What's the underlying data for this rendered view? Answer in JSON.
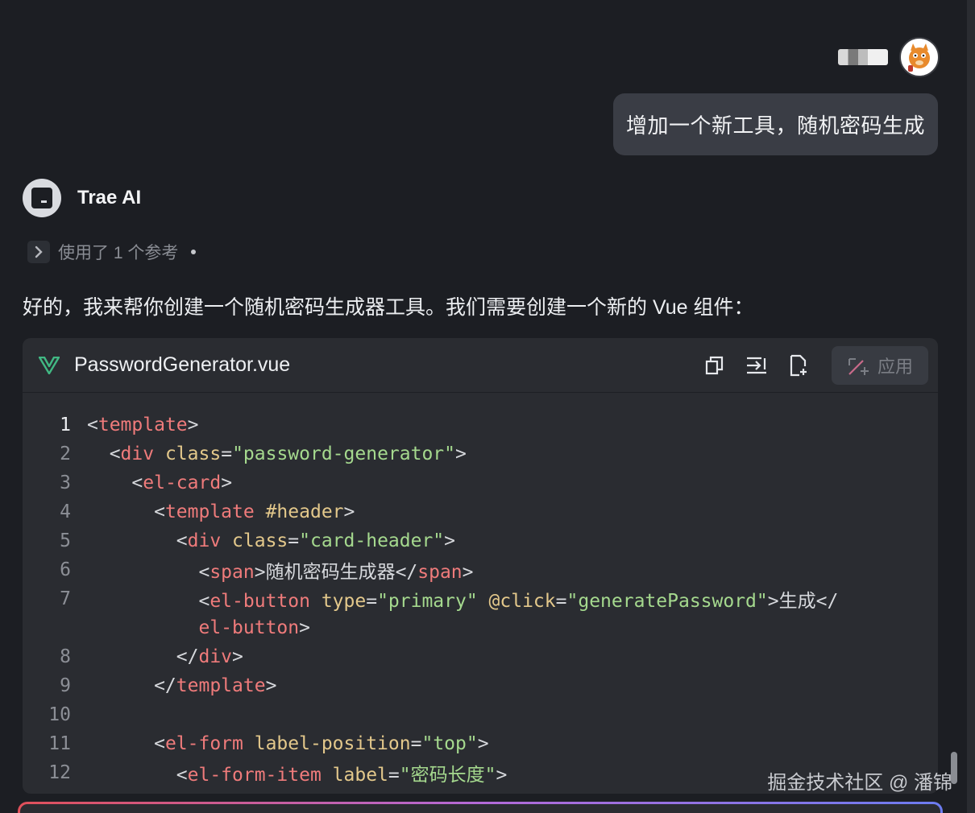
{
  "user": {
    "message": "增加一个新工具，随机密码生成"
  },
  "assistant": {
    "name": "Trae AI",
    "references_label": "使用了 1 个参考",
    "intro": "好的，我来帮你创建一个随机密码生成器工具。我们需要创建一个新的 Vue 组件："
  },
  "code_block": {
    "file_name": "PasswordGenerator.vue",
    "file_icon": "vue-logo-icon",
    "apply_label": "应用",
    "toolbar_icons": [
      "copy-icon",
      "insert-icon",
      "new-file-icon",
      "apply-magic-icon"
    ],
    "lines": [
      {
        "num": "1",
        "tokens": [
          [
            "punc",
            "<"
          ],
          [
            "tag",
            "template"
          ],
          [
            "punc",
            ">"
          ]
        ]
      },
      {
        "num": "2",
        "tokens": [
          [
            "punc",
            "  <"
          ],
          [
            "tag",
            "div"
          ],
          [
            "punc",
            " "
          ],
          [
            "attr",
            "class"
          ],
          [
            "punc",
            "="
          ],
          [
            "str",
            "\"password-generator\""
          ],
          [
            "punc",
            ">"
          ]
        ]
      },
      {
        "num": "3",
        "tokens": [
          [
            "punc",
            "    <"
          ],
          [
            "tag",
            "el-card"
          ],
          [
            "punc",
            ">"
          ]
        ]
      },
      {
        "num": "4",
        "tokens": [
          [
            "punc",
            "      <"
          ],
          [
            "tag",
            "template"
          ],
          [
            "punc",
            " "
          ],
          [
            "attr",
            "#header"
          ],
          [
            "punc",
            ">"
          ]
        ]
      },
      {
        "num": "5",
        "tokens": [
          [
            "punc",
            "        <"
          ],
          [
            "tag",
            "div"
          ],
          [
            "punc",
            " "
          ],
          [
            "attr",
            "class"
          ],
          [
            "punc",
            "="
          ],
          [
            "str",
            "\"card-header\""
          ],
          [
            "punc",
            ">"
          ]
        ]
      },
      {
        "num": "6",
        "tokens": [
          [
            "punc",
            "          <"
          ],
          [
            "tag",
            "span"
          ],
          [
            "punc",
            ">随机密码生成器</"
          ],
          [
            "tag",
            "span"
          ],
          [
            "punc",
            ">"
          ]
        ]
      },
      {
        "num": "7",
        "tokens": [
          [
            "punc",
            "          <"
          ],
          [
            "tag",
            "el-button"
          ],
          [
            "punc",
            " "
          ],
          [
            "attr",
            "type"
          ],
          [
            "punc",
            "="
          ],
          [
            "str",
            "\"primary\""
          ],
          [
            "punc",
            " "
          ],
          [
            "attr",
            "@click"
          ],
          [
            "punc",
            "="
          ],
          [
            "str",
            "\"generatePassword\""
          ],
          [
            "punc",
            ">生成</"
          ]
        ]
      },
      {
        "num": "",
        "tokens": [
          [
            "punc",
            "          "
          ],
          [
            "tag",
            "el-button"
          ],
          [
            "punc",
            ">"
          ]
        ]
      },
      {
        "num": "8",
        "tokens": [
          [
            "punc",
            "        </"
          ],
          [
            "tag",
            "div"
          ],
          [
            "punc",
            ">"
          ]
        ]
      },
      {
        "num": "9",
        "tokens": [
          [
            "punc",
            "      </"
          ],
          [
            "tag",
            "template"
          ],
          [
            "punc",
            ">"
          ]
        ]
      },
      {
        "num": "10",
        "tokens": []
      },
      {
        "num": "11",
        "tokens": [
          [
            "punc",
            "      <"
          ],
          [
            "tag",
            "el-form"
          ],
          [
            "punc",
            " "
          ],
          [
            "attr",
            "label-position"
          ],
          [
            "punc",
            "="
          ],
          [
            "str",
            "\"top\""
          ],
          [
            "punc",
            ">"
          ]
        ]
      },
      {
        "num": "12",
        "tokens": [
          [
            "punc",
            "        <"
          ],
          [
            "tag",
            "el-form-item"
          ],
          [
            "punc",
            " "
          ],
          [
            "attr",
            "label"
          ],
          [
            "punc",
            "="
          ],
          [
            "str",
            "\"密码长度\""
          ],
          [
            "punc",
            ">"
          ]
        ]
      }
    ]
  },
  "watermark": "掘金技术社区 @ 潘锦"
}
